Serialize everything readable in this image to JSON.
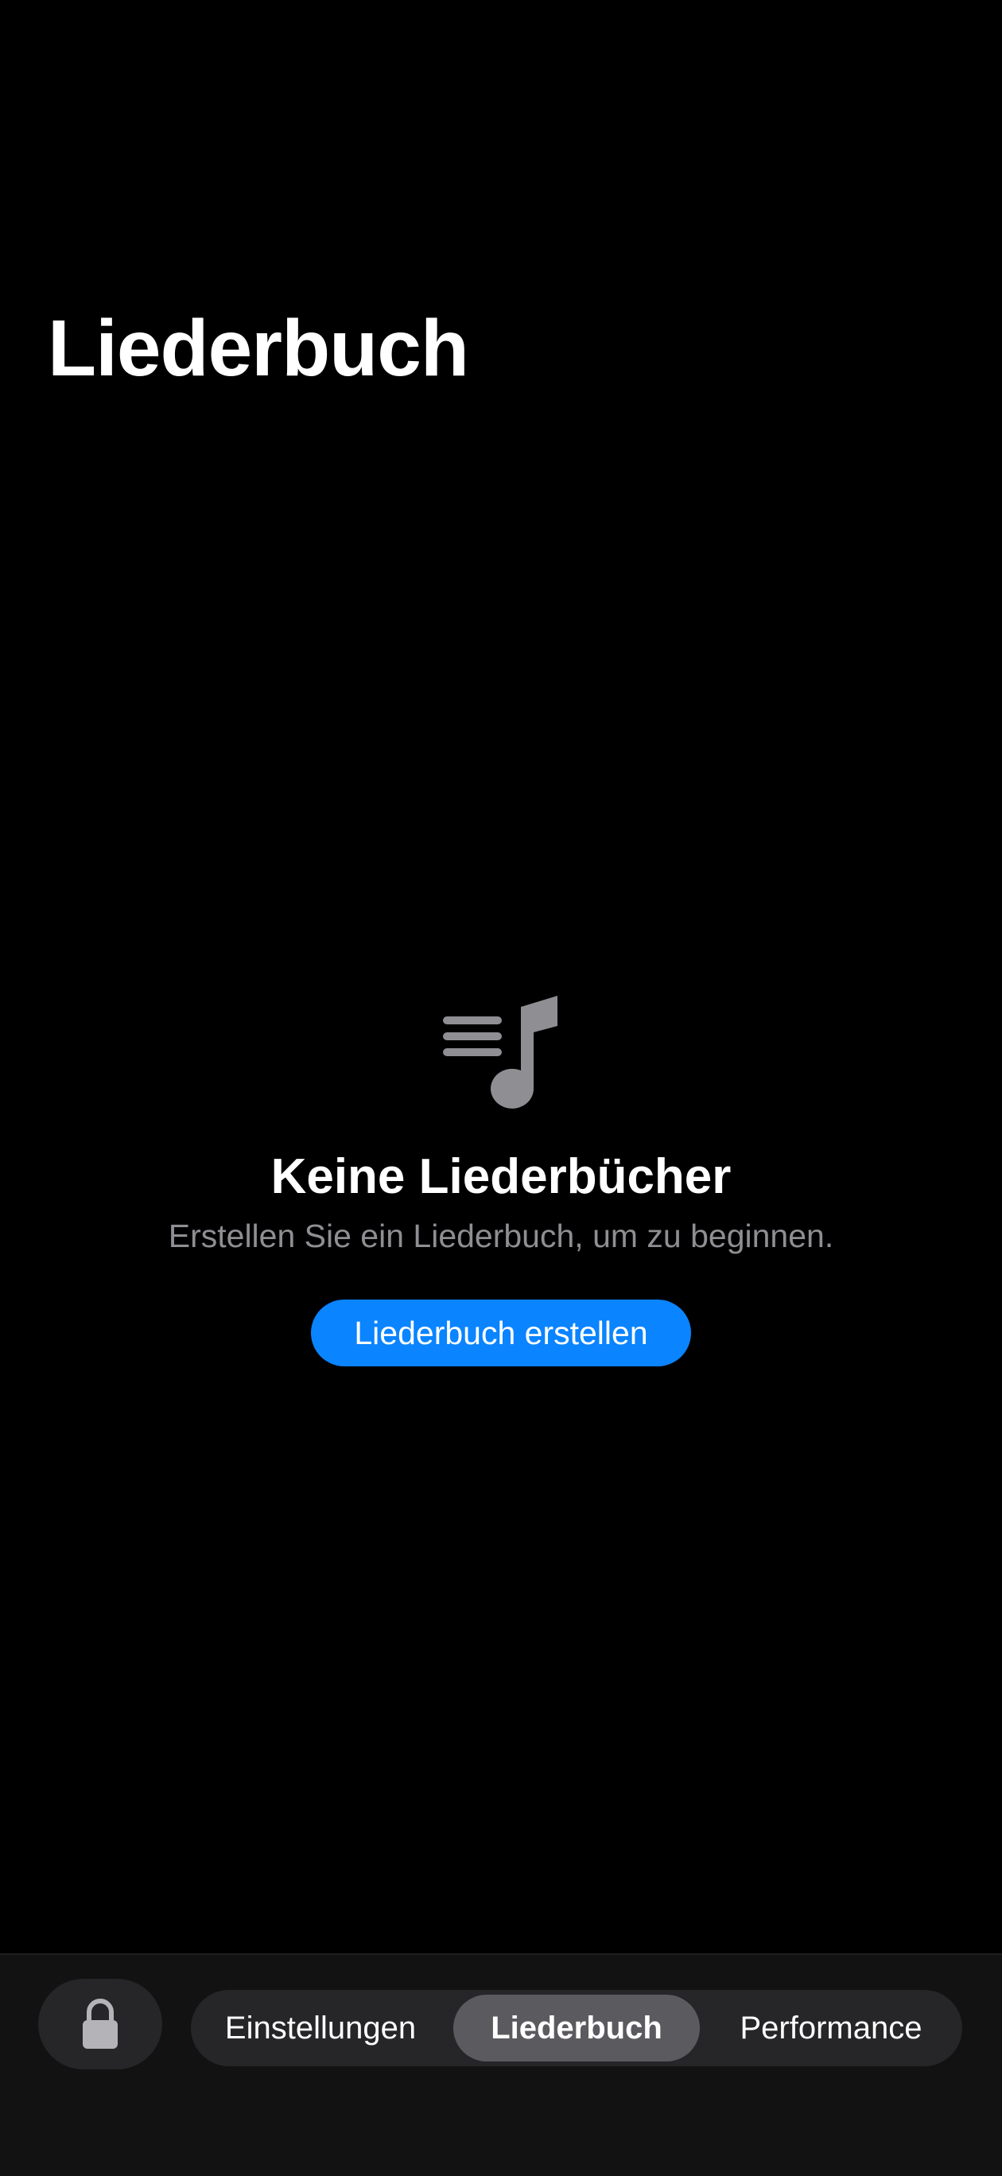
{
  "header": {
    "title": "Liederbuch"
  },
  "empty_state": {
    "icon": "music-list-icon",
    "title": "Keine Liederbücher",
    "subtitle": "Erstellen Sie ein Liederbuch, um zu beginnen.",
    "button_label": "Liederbuch erstellen"
  },
  "tab_bar": {
    "lock_icon": "lock-icon",
    "tabs": [
      {
        "label": "Einstellungen",
        "selected": false
      },
      {
        "label": "Liederbuch",
        "selected": true
      },
      {
        "label": "Performance",
        "selected": false
      }
    ]
  },
  "colors": {
    "background": "#000000",
    "accent": "#0a84ff",
    "secondary_text": "#8e8e93",
    "icon_gray": "#8e8e93",
    "bar_background": "#121212",
    "segment_background": "#262628",
    "segment_selected": "#5b5b5f"
  }
}
